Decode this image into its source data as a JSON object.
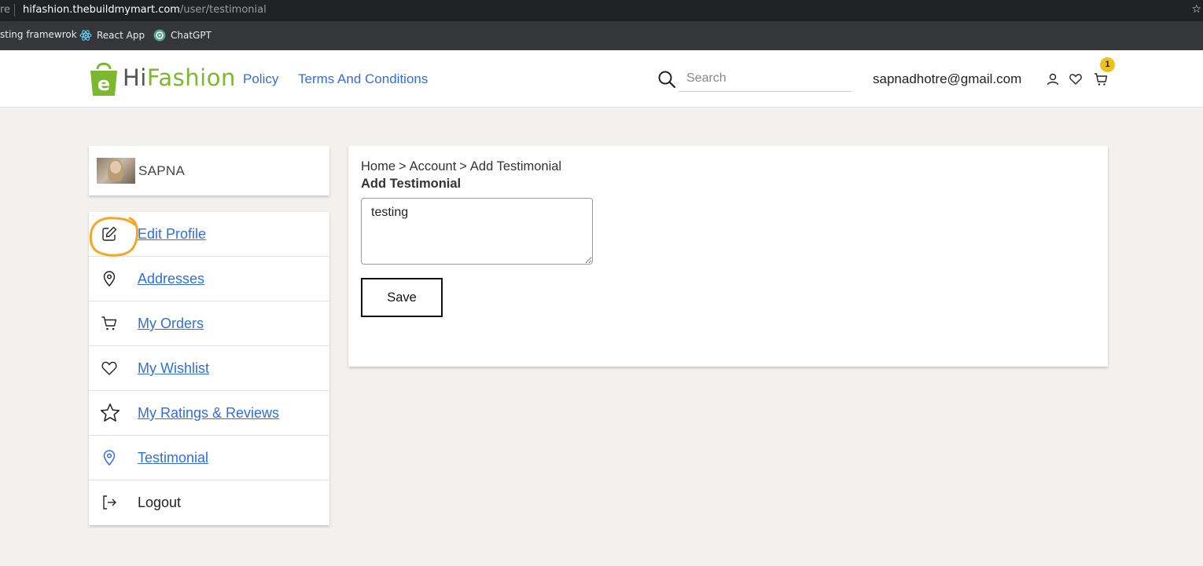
{
  "browser": {
    "cut_text": "re",
    "url_host": "hifashion.thebuildmymart.com",
    "url_path": "/user/testimonial",
    "bookmarks": [
      {
        "label": "sting framewrok"
      },
      {
        "label": "React App",
        "icon": "react-icon"
      },
      {
        "label": "ChatGPT",
        "icon": "chatgpt-icon"
      }
    ]
  },
  "header": {
    "logo_hi": "Hi",
    "logo_fashion": "Fashion",
    "nav": [
      "Policy",
      "Terms And Conditions"
    ],
    "search_placeholder": "Search",
    "user_email": "sapnadhotre@gmail.com",
    "cart_count": "1",
    "colors": {
      "brand_green": "#7cb82f",
      "link_blue": "#2f6fdb",
      "badge_yellow": "#f2c01a"
    }
  },
  "sidebar": {
    "profile_name": "SAPNA",
    "items": [
      {
        "label": "Edit Profile",
        "icon": "edit-icon"
      },
      {
        "label": "Addresses",
        "icon": "location-pin-icon"
      },
      {
        "label": "My Orders",
        "icon": "cart-icon"
      },
      {
        "label": "My Wishlist",
        "icon": "heart-icon"
      },
      {
        "label": "My Ratings & Reviews",
        "icon": "star-icon"
      },
      {
        "label": "Testimonial",
        "icon": "location-pin-icon"
      },
      {
        "label": "Logout",
        "icon": "logout-icon"
      }
    ]
  },
  "main": {
    "breadcrumb": [
      "Home",
      "Account",
      "Add Testimonial"
    ],
    "breadcrumb_sep": ">",
    "title": "Add Testimonial",
    "testimonial_value": "testing",
    "save_label": "Save"
  }
}
